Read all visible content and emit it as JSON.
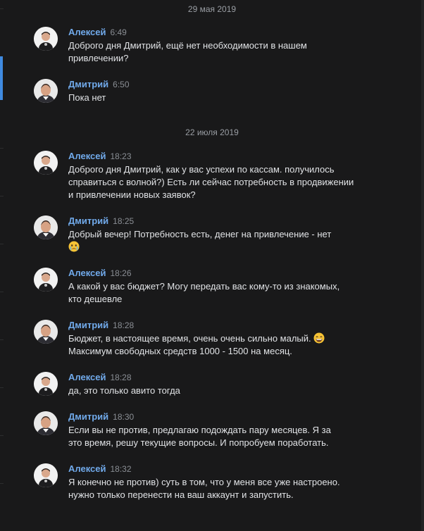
{
  "dates": [
    "29 мая 2019",
    "22 июля 2019"
  ],
  "messages": [
    {
      "author": "Алексей",
      "time": "6:49",
      "lines": [
        "Доброго дня Дмитрий, ещё нет необходимости в нашем",
        "привлечении?"
      ]
    },
    {
      "author": "Дмитрий",
      "time": "6:50",
      "lines": [
        "Пока нет"
      ]
    },
    {
      "author": "Алексей",
      "time": "18:23",
      "lines": [
        "Доброго дня Дмитрий, как у вас успехи по кассам. получилось",
        "справиться с волной?) Есть ли сейчас потребность в продвижении",
        "и привлечении новых заявок?"
      ]
    },
    {
      "author": "Дмитрий",
      "time": "18:25",
      "lines": [
        "Добрый вечер! Потребность есть, денег на привлечение - нет"
      ],
      "emoji_line": "crying-face-emoji"
    },
    {
      "author": "Алексей",
      "time": "18:26",
      "lines": [
        "А какой у вас бюджет? Могу передать вас кому-то из знакомых,",
        "кто дешевле"
      ]
    },
    {
      "author": "Дмитрий",
      "time": "18:28",
      "lines": [
        "Бюджет, в настоящее время, очень очень сильно малый.",
        "Максимум свободных средств 1000 - 1500 на месяц."
      ],
      "inline_emoji": "grinning-face-emoji"
    },
    {
      "author": "Алексей",
      "time": "18:28",
      "lines": [
        "да, это только авито тогда"
      ]
    },
    {
      "author": "Дмитрий",
      "time": "18:30",
      "lines": [
        "Если вы не против, предлагаю подождать пару месяцев. Я за",
        "это время, решу текущие вопросы. И попробуем поработать."
      ]
    },
    {
      "author": "Алексей",
      "time": "18:32",
      "lines": [
        "Я конечно не против) суть в том, что у меня все уже настроено.",
        "нужно только перенести на ваш аккаунт и запустить."
      ]
    }
  ],
  "colors": {
    "background": "#19191a",
    "author": "#71aaeb",
    "text": "#e1e3e6",
    "muted": "#8a8e94",
    "accent": "#3f8ae0"
  }
}
